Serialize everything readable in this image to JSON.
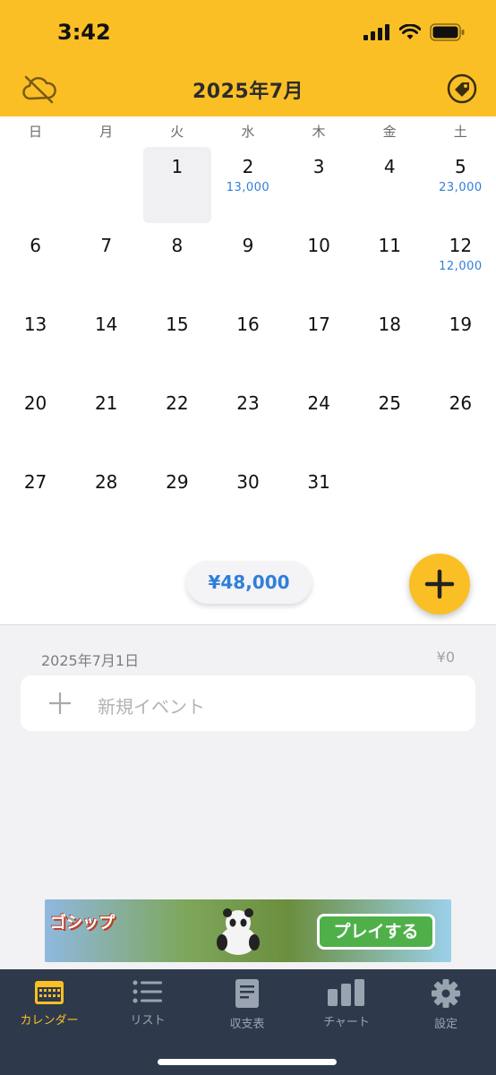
{
  "status_bar": {
    "time": "3:42"
  },
  "header": {
    "title": "2025年7月",
    "left_icon": "cloud-off-icon",
    "right_icon": "tag-icon"
  },
  "calendar": {
    "weekdays": [
      "日",
      "月",
      "火",
      "水",
      "木",
      "金",
      "土"
    ],
    "selected_day": 1,
    "days": [
      {
        "d": "1",
        "amount": ""
      },
      {
        "d": "2",
        "amount": "13,000"
      },
      {
        "d": "3",
        "amount": ""
      },
      {
        "d": "4",
        "amount": ""
      },
      {
        "d": "5",
        "amount": "23,000"
      },
      {
        "d": "6",
        "amount": ""
      },
      {
        "d": "7",
        "amount": ""
      },
      {
        "d": "8",
        "amount": ""
      },
      {
        "d": "9",
        "amount": ""
      },
      {
        "d": "10",
        "amount": ""
      },
      {
        "d": "11",
        "amount": ""
      },
      {
        "d": "12",
        "amount": "12,000"
      },
      {
        "d": "13",
        "amount": ""
      },
      {
        "d": "14",
        "amount": ""
      },
      {
        "d": "15",
        "amount": ""
      },
      {
        "d": "16",
        "amount": ""
      },
      {
        "d": "17",
        "amount": ""
      },
      {
        "d": "18",
        "amount": ""
      },
      {
        "d": "19",
        "amount": ""
      },
      {
        "d": "20",
        "amount": ""
      },
      {
        "d": "21",
        "amount": ""
      },
      {
        "d": "22",
        "amount": ""
      },
      {
        "d": "23",
        "amount": ""
      },
      {
        "d": "24",
        "amount": ""
      },
      {
        "d": "25",
        "amount": ""
      },
      {
        "d": "26",
        "amount": ""
      },
      {
        "d": "27",
        "amount": ""
      },
      {
        "d": "28",
        "amount": ""
      },
      {
        "d": "29",
        "amount": ""
      },
      {
        "d": "30",
        "amount": ""
      },
      {
        "d": "31",
        "amount": ""
      }
    ],
    "month_total": "¥48,000"
  },
  "detail": {
    "date_label": "2025年7月1日",
    "date_total": "¥0",
    "new_event_placeholder": "新規イベント"
  },
  "ad": {
    "logo_text": "ゴシップ",
    "button_label": "プレイする"
  },
  "tabs": [
    {
      "label": "カレンダー",
      "icon": "calendar-icon",
      "active": true
    },
    {
      "label": "リスト",
      "icon": "list-icon",
      "active": false
    },
    {
      "label": "収支表",
      "icon": "document-icon",
      "active": false
    },
    {
      "label": "チャート",
      "icon": "bar-chart-icon",
      "active": false
    },
    {
      "label": "設定",
      "icon": "gear-icon",
      "active": false
    }
  ],
  "colors": {
    "accent": "#fbbf26",
    "amount": "#2f7fd9",
    "tabbar": "#2e3a4c"
  }
}
